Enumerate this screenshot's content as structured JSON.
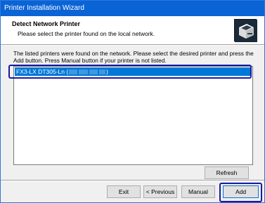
{
  "window": {
    "title": "Printer Installation Wizard"
  },
  "header": {
    "title": "Detect Network Printer",
    "subtitle": "Please select the printer found on the local network.",
    "icon": "printer-wizard-icon"
  },
  "description": "The listed printers were found on the network. Please select the desired printer and press the Add button. Press Manual button if your printer is not listed.",
  "printer_list": {
    "items": [
      {
        "label_prefix": "FX3-LX DT305-Ln (",
        "label_suffix": ")",
        "selected": true
      }
    ]
  },
  "buttons": {
    "refresh": "Refresh",
    "exit": "Exit",
    "previous": "< Previous",
    "manual": "Manual",
    "add": "Add"
  },
  "colors": {
    "titlebar": "#0a64d6",
    "selection": "#0078d7",
    "highlight": "#1a1aa6"
  }
}
